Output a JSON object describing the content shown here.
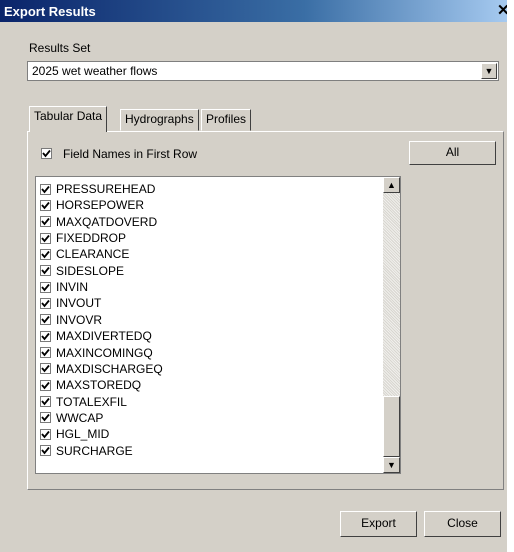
{
  "window": {
    "title": "Export Results",
    "close_glyph": "✕"
  },
  "results_set": {
    "label": "Results Set",
    "selected": "2025 wet weather flows",
    "arrow": "▼"
  },
  "tabs": [
    {
      "label": "Tabular Data",
      "active": true
    },
    {
      "label": "Hydrographs",
      "active": false
    },
    {
      "label": "Profiles",
      "active": false
    }
  ],
  "field_names_first_row": {
    "label": "Field Names in First Row",
    "checked": true
  },
  "all_button": "All",
  "fields": [
    {
      "label": "PRESSUREHEAD",
      "checked": true
    },
    {
      "label": "HORSEPOWER",
      "checked": true
    },
    {
      "label": "MAXQATDOVERD",
      "checked": true
    },
    {
      "label": "FIXEDDROP",
      "checked": true
    },
    {
      "label": "CLEARANCE",
      "checked": true
    },
    {
      "label": "SIDESLOPE",
      "checked": true
    },
    {
      "label": "INVIN",
      "checked": true
    },
    {
      "label": "INVOUT",
      "checked": true
    },
    {
      "label": "INVOVR",
      "checked": true
    },
    {
      "label": "MAXDIVERTEDQ",
      "checked": true
    },
    {
      "label": "MAXINCOMINGQ",
      "checked": true
    },
    {
      "label": "MAXDISCHARGEQ",
      "checked": true
    },
    {
      "label": "MAXSTOREDQ",
      "checked": true
    },
    {
      "label": "TOTALEXFIL",
      "checked": true
    },
    {
      "label": "WWCAP",
      "checked": true
    },
    {
      "label": "HGL_MID",
      "checked": true
    },
    {
      "label": "SURCHARGE",
      "checked": true
    }
  ],
  "scrollbar": {
    "up_arrow": "▲",
    "down_arrow": "▼"
  },
  "footer": {
    "export_label": "Export",
    "close_label": "Close"
  }
}
